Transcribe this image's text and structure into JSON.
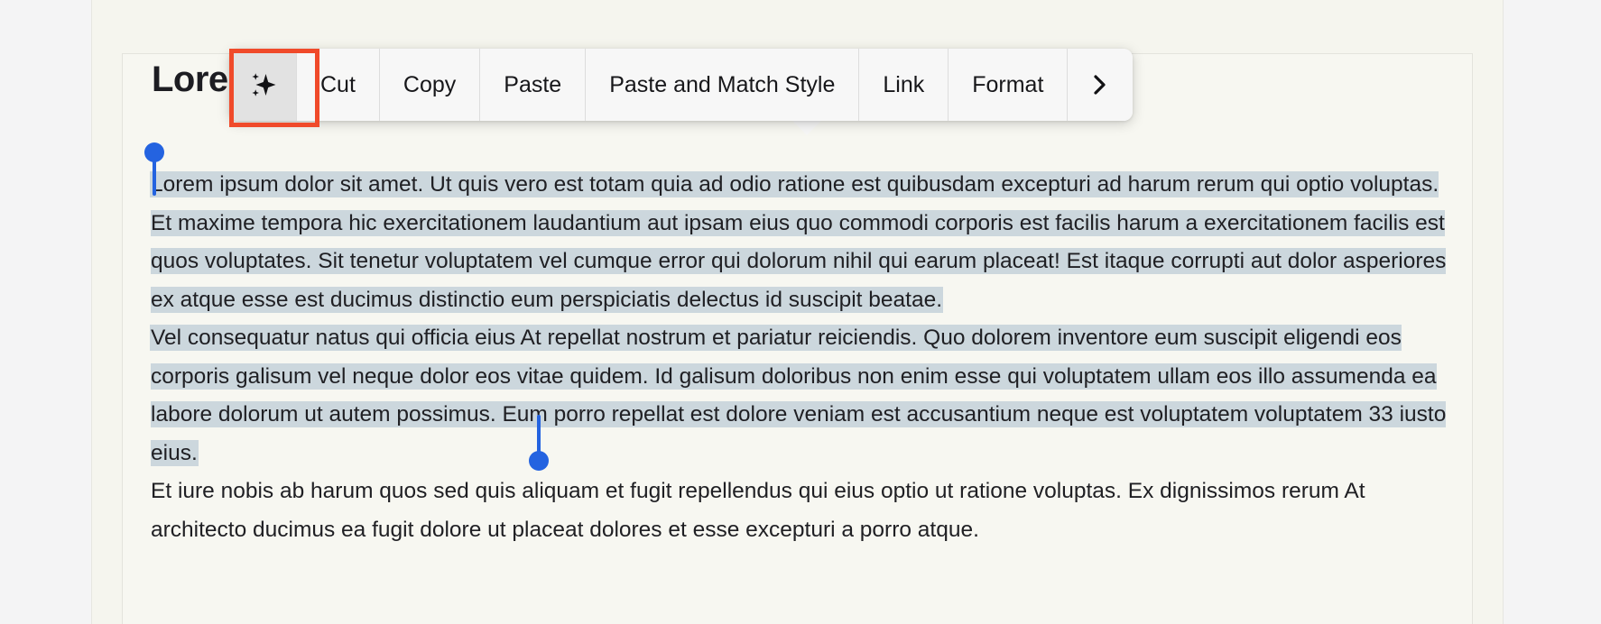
{
  "document": {
    "title": "Lorem",
    "paragraphs": [
      {
        "id": "selected-paragraph",
        "selected": true,
        "text": "Lorem ipsum dolor sit amet. Ut quis vero est totam quia ad odio ratione est quibusdam excepturi ad harum rerum qui optio voluptas. Et maxime tempora hic exercitationem laudantium aut ipsam eius quo commodi corporis est facilis harum a exercitationem facilis est quos voluptates. Sit tenetur voluptatem vel cumque error qui dolorum nihil qui earum placeat! Est itaque corrupti aut dolor asperiores ex atque esse est ducimus distinctio eum perspiciatis delectus id suscipit beatae."
      },
      {
        "id": "selected-paragraph-2",
        "selected": true,
        "text": "Vel consequatur natus qui officia eius At repellat nostrum et pariatur reiciendis. Quo dolorem inventore eum suscipit eligendi eos corporis galisum vel neque dolor eos vitae quidem. Id galisum doloribus non enim esse qui voluptatem ullam eos illo assumenda ea labore dolorum ut autem possimus. Eum porro repellat est dolore veniam est accusantium neque est voluptatem voluptatem 33 iusto eius."
      },
      {
        "id": "unselected-paragraph",
        "selected": false,
        "text": "Et iure nobis ab harum quos sed quis aliquam et fugit repellendus qui eius optio ut ratione voluptas. Ex dignissimos rerum At architecto ducimus ea fugit dolore ut placeat dolores et esse excepturi a porro atque."
      }
    ]
  },
  "context_menu": {
    "items": [
      {
        "id": "ai-writing-tools",
        "label": "",
        "icon": "sparkle-icon",
        "active": true
      },
      {
        "id": "cut",
        "label": "Cut",
        "icon": "",
        "active": false
      },
      {
        "id": "copy",
        "label": "Copy",
        "icon": "",
        "active": false
      },
      {
        "id": "paste",
        "label": "Paste",
        "icon": "",
        "active": false
      },
      {
        "id": "paste-and-match-style",
        "label": "Paste and Match Style",
        "icon": "",
        "active": false
      },
      {
        "id": "link",
        "label": "Link",
        "icon": "",
        "active": false
      },
      {
        "id": "format",
        "label": "Format",
        "icon": "",
        "active": false
      },
      {
        "id": "more",
        "label": "",
        "icon": "chevron-right-icon",
        "active": false
      }
    ],
    "labels": {
      "cut": "Cut",
      "copy": "Copy",
      "paste": "Paste",
      "paste_and_match_style": "Paste and Match Style",
      "link": "Link",
      "format": "Format"
    }
  },
  "annotation": {
    "highlight_target": "ai-writing-tools",
    "highlight_color": "#f04a2a"
  },
  "colors": {
    "selection_highlight": "#ccd7dd",
    "handle": "#2463e0",
    "page_background": "#f5f5ee",
    "outer_background": "#f4f4f5",
    "toolbar_background": "#f7f7f7",
    "toolbar_active_background": "#e2e2e2",
    "text": "#1f1f23"
  }
}
